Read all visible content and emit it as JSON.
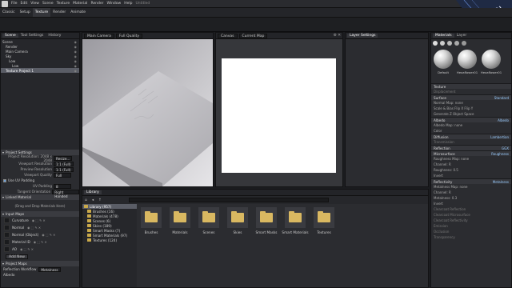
{
  "menubar": {
    "items": [
      "File",
      "Edit",
      "View",
      "Scene",
      "Texture",
      "Material",
      "Render",
      "Window",
      "Help"
    ],
    "doc_title": "Untitled"
  },
  "tabs": {
    "items": [
      "Classic",
      "Setup",
      "Texture",
      "Render",
      "Animate"
    ],
    "active": 2
  },
  "left_panel": {
    "tabs": [
      "Scene",
      "Tool Settings",
      "History"
    ],
    "tree": [
      {
        "label": "Scene",
        "indent": 0
      },
      {
        "label": "Render",
        "indent": 1
      },
      {
        "label": "Main Camera",
        "indent": 1
      },
      {
        "label": "Sky",
        "indent": 1
      },
      {
        "label": "Low",
        "indent": 2
      },
      {
        "label": "Low",
        "indent": 3
      },
      {
        "label": "Texture Project 1",
        "indent": 1,
        "selected": true
      }
    ],
    "project_settings": {
      "header": "Project Settings",
      "fields": [
        {
          "label": "Project Resolution: 2048 x 2048",
          "value": "Resize..."
        },
        {
          "label": "Viewport Resolution",
          "value": "1:1 (Full)"
        },
        {
          "label": "Preview Resolution",
          "value": "1:1 (Full)"
        },
        {
          "label": "Viewport Quality",
          "value": "Full"
        }
      ],
      "uv_padding_check": "Use UV Padding",
      "uv_padding_label": "UV Padding",
      "uv_padding_value": "8",
      "tangent_label": "Tangent Orientation",
      "tangent_value": "Right Handed"
    },
    "linked_materials": {
      "header": "Linked Material",
      "drop_text": "(Drag and Drop Materials Here)"
    },
    "input_maps": {
      "header": "Input Maps",
      "items": [
        "Curvature",
        "Normal",
        "Normal (Object)",
        "Material ID",
        "AO"
      ],
      "add_button": "Add New"
    },
    "project_maps": {
      "header": "Project Maps",
      "reflection_label": "Reflection Workflow",
      "reflection_value": "Metalness",
      "albedo": "Albedo"
    }
  },
  "viewport3d": {
    "camera": "Main Camera",
    "quality": "Full Quality"
  },
  "viewport2d": {
    "channel": "Canvas",
    "map": "Current Map"
  },
  "layer_panel": {
    "title": "Layer Settings"
  },
  "library": {
    "title": "Library",
    "tree": [
      {
        "label": "Library (957)",
        "indent": 0,
        "selected": true
      },
      {
        "label": "Brushes (16)",
        "indent": 1
      },
      {
        "label": "Materials (478)",
        "indent": 1
      },
      {
        "label": "Scenes (6)",
        "indent": 1
      },
      {
        "label": "Skies (189)",
        "indent": 1
      },
      {
        "label": "Smart Masks (7)",
        "indent": 1
      },
      {
        "label": "Smart Materials (97)",
        "indent": 1
      },
      {
        "label": "Textures (124)",
        "indent": 1
      }
    ],
    "folders": [
      "Brushes",
      "Materials",
      "Scenes",
      "Skies",
      "Smart Masks",
      "Smart Materials",
      "Textures"
    ]
  },
  "right_panel": {
    "tabs": [
      "Materials",
      "Layer"
    ],
    "materials": [
      "Default",
      "Hexaflower01",
      "Hexaflower01"
    ],
    "sections": [
      {
        "type": "sect",
        "label": "Texture"
      },
      {
        "type": "field",
        "label": "Displacement",
        "dim": true
      },
      {
        "type": "sect",
        "label": "Surface",
        "value": "Standard"
      },
      {
        "type": "field",
        "label": "Normal Map: none"
      },
      {
        "type": "field",
        "label": "Scale & Bias    Flip X    Flip Y"
      },
      {
        "type": "field",
        "label": "Generate Z    Object Space"
      },
      {
        "type": "sect",
        "label": "Albedo",
        "value": "Albedo"
      },
      {
        "type": "field",
        "label": "Albedo Map: none"
      },
      {
        "type": "field",
        "label": "Color"
      },
      {
        "type": "sect",
        "label": "Diffusion",
        "value": "Lambertian"
      },
      {
        "type": "field",
        "label": "Transmission",
        "dim": true
      },
      {
        "type": "sect",
        "label": "Reflection",
        "value": "GGX"
      },
      {
        "type": "sect",
        "label": "Microsurface",
        "value": "Roughness"
      },
      {
        "type": "field",
        "label": "Roughness Map: none"
      },
      {
        "type": "field",
        "label": "Channel: R"
      },
      {
        "type": "field",
        "label": "Roughness: 0.5"
      },
      {
        "type": "field",
        "label": "Invert"
      },
      {
        "type": "sect",
        "label": "Reflectivity",
        "value": "Metalness"
      },
      {
        "type": "field",
        "label": "Metalness Map: none"
      },
      {
        "type": "field",
        "label": "Channel: R"
      },
      {
        "type": "field",
        "label": "Metalness: 0.3"
      },
      {
        "type": "field",
        "label": "Invert"
      },
      {
        "type": "field",
        "label": "Clearcoat Reflection",
        "dim": true
      },
      {
        "type": "field",
        "label": "Clearcoat Microsurface",
        "dim": true
      },
      {
        "type": "field",
        "label": "Clearcoat Reflectivity",
        "dim": true
      },
      {
        "type": "field",
        "label": "Emission",
        "dim": true
      },
      {
        "type": "field",
        "label": "Occlusion",
        "dim": true
      },
      {
        "type": "field",
        "label": "Transparency",
        "dim": true
      }
    ]
  },
  "colors": {
    "accent": "#6a9fd8",
    "bg": "#1b1c1f",
    "panel": "#2b2c30"
  }
}
